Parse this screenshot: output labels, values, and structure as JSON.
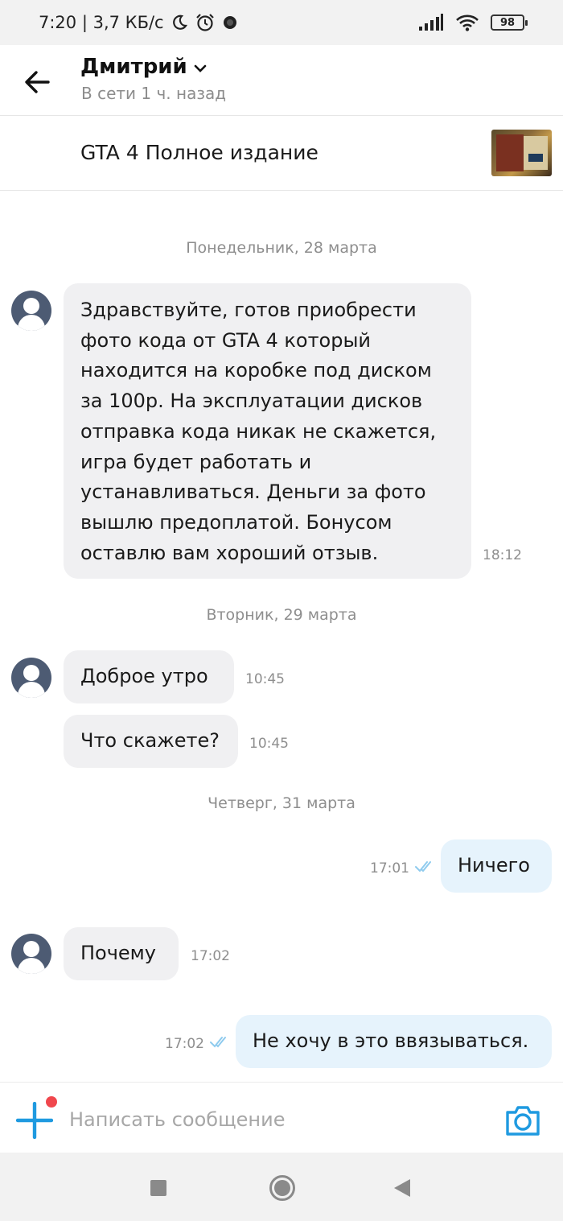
{
  "status_bar": {
    "time_speed": "7:20 | 3,7 КБ/с",
    "battery": "98",
    "icons": [
      "moon-icon",
      "alarm-icon",
      "notification-dot-icon",
      "signal-icon",
      "wifi-icon",
      "battery-icon"
    ]
  },
  "header": {
    "back_icon": "arrow-left-icon",
    "contact_name": "Дмитрий",
    "contact_status": "В сети 1 ч. назад"
  },
  "listing": {
    "title": "GTA 4 Полное издание"
  },
  "dates": {
    "d1": "Понедельник, 28 марта",
    "d2": "Вторник, 29 марта",
    "d3": "Четверг, 31 марта"
  },
  "messages": [
    {
      "direction": "incoming",
      "text": "Здравствуйте, готов приобрести\nфото кода от GTA 4 который\nнаходится на коробке под диском\nза 100р. На эксплуатации дисков\nотправка кода никак не скажется,\nигра будет работать и\nустанавливаться. Деньги за фото\nвышлю предоплатой. Бонусом\nоставлю вам хороший отзыв.",
      "time": "18:12"
    },
    {
      "direction": "incoming",
      "text": "Доброе утро",
      "time": "10:45"
    },
    {
      "direction": "incoming",
      "text": "Что скажете?",
      "time": "10:45"
    },
    {
      "direction": "outgoing",
      "text": "Ничего",
      "time": "17:01",
      "read": true
    },
    {
      "direction": "incoming",
      "text": "Почему",
      "time": "17:02"
    },
    {
      "direction": "outgoing",
      "text": "Не хочу в это ввязываться.",
      "time": "17:02",
      "read": true
    }
  ],
  "input": {
    "placeholder": "Написать сообщение"
  },
  "colors": {
    "incoming_bubble": "#f0f0f2",
    "outgoing_bubble": "#e6f3fc",
    "accent": "#1f9ae0",
    "avatar": "#4d5b73",
    "notification": "#f0474d"
  }
}
